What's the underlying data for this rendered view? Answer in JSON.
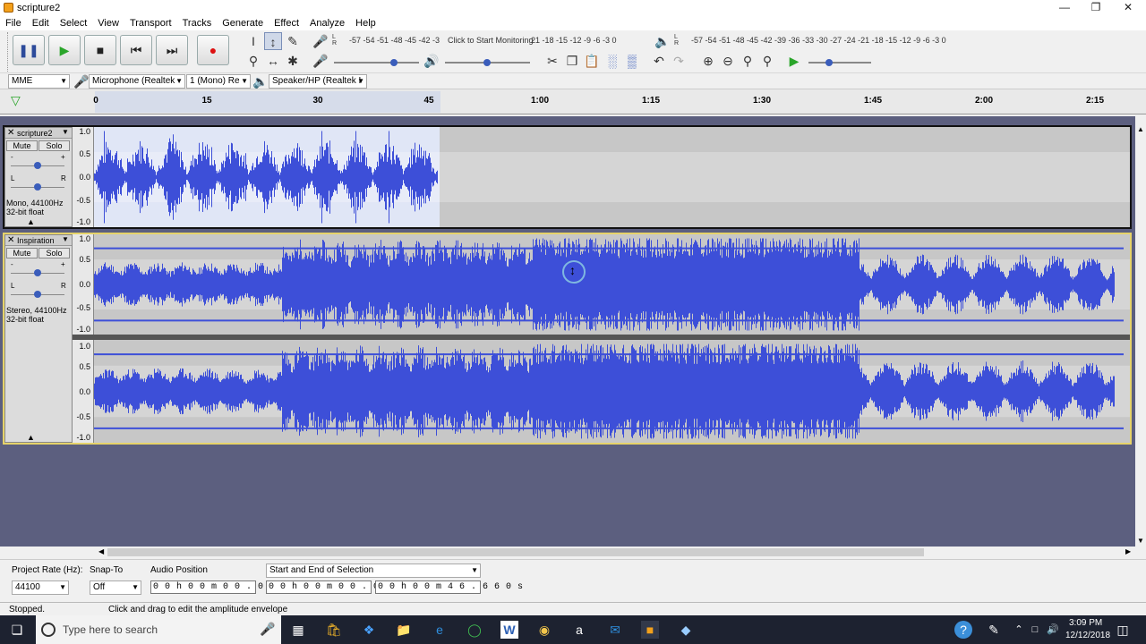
{
  "window": {
    "title": "scripture2"
  },
  "menu": [
    "File",
    "Edit",
    "Select",
    "View",
    "Transport",
    "Tracks",
    "Generate",
    "Effect",
    "Analyze",
    "Help"
  ],
  "transport": {
    "pause": "pause-icon",
    "play": "play-icon",
    "stop": "stop-icon",
    "skip_start": "skip-start-icon",
    "skip_end": "skip-end-icon",
    "record": "record-icon"
  },
  "meters": {
    "record_scale": "-57 -54 -51 -48 -45 -42 -3",
    "record_hint": "Click to Start Monitoring",
    "record_scale2": "21 -18 -15 -12 -9 -6 -3 0",
    "play_scale": "-57 -54 -51 -48 -45 -42 -39 -36 -33 -30 -27 -24 -21 -18 -15 -12 -9 -6 -3 0",
    "lr": "L\nR"
  },
  "devices": {
    "host": "MME",
    "mic": "Microphone (Realtek",
    "channels": "1 (Mono) Re",
    "speaker": "Speaker/HP (Realtek I"
  },
  "ruler": [
    "0",
    "15",
    "30",
    "45",
    "1:00",
    "1:15",
    "1:30",
    "1:45",
    "2:00",
    "2:15"
  ],
  "tracks": [
    {
      "name": "scripture2",
      "mute": "Mute",
      "solo": "Solo",
      "info": "Mono, 44100Hz\n32-bit float",
      "gain_minus": "-",
      "gain_plus": "+",
      "pan_l": "L",
      "pan_r": "R"
    },
    {
      "name": "Inspiration",
      "mute": "Mute",
      "solo": "Solo",
      "info": "Stereo, 44100Hz\n32-bit float",
      "gain_minus": "-",
      "gain_plus": "+",
      "pan_l": "L",
      "pan_r": "R"
    }
  ],
  "vruler": [
    "1.0",
    "0.5",
    "0.0",
    "-0.5",
    "-1.0"
  ],
  "selection": {
    "project_rate_label": "Project Rate (Hz):",
    "project_rate": "44100",
    "snap_label": "Snap-To",
    "snap": "Off",
    "audio_pos_label": "Audio Position",
    "audio_pos": "0 0 h 0 0 m 0 0 . 0 0 0 s",
    "sel_label": "Start and End of Selection",
    "start": "0 0 h 0 0 m 0 0 . 0 0 0 s",
    "end": "0 0 h 0 0 m 4 6 . 6 6 0 s"
  },
  "status": {
    "state": "Stopped.",
    "hint": "Click and drag to edit the amplitude envelope"
  },
  "taskbar": {
    "search_placeholder": "Type here to search",
    "time": "3:09 PM",
    "date": "12/12/2018"
  },
  "colors": {
    "wave": "#3d4fd8",
    "selected": "#e0e6f6",
    "track_bg": "#c7c7c7",
    "record": "#d11"
  }
}
